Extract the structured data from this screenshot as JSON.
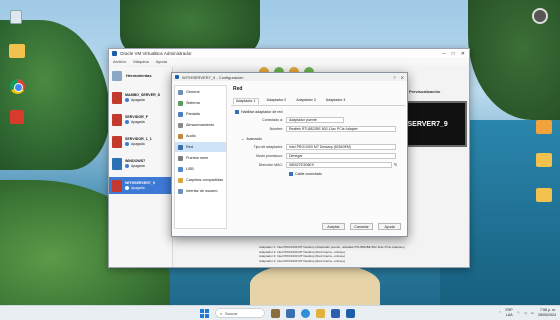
{
  "window": {
    "title": "Oracle VM VirtualBox Administrador",
    "menu": [
      "Archivo",
      "Máquina",
      "Ayuda"
    ]
  },
  "sidebar": {
    "tools_label": "Herramientas",
    "vms": [
      {
        "name": "MAMBO_SERVER_D",
        "state": "Apagada"
      },
      {
        "name": "SERVIDOR_F",
        "state": "Apagada"
      },
      {
        "name": "SERVIDOR_1_1",
        "state": "Apagada"
      },
      {
        "name": "WINDOWS7",
        "state": "Apagada"
      },
      {
        "name": "WITHSERVER7_9",
        "state": "Apagada",
        "selected": true
      }
    ]
  },
  "preview": {
    "header": "Previsualización",
    "screen_text": "THSERVER7_9"
  },
  "details_lines": [
    "Adaptador 1:  Intel PRO/1000 MT Desktop (Adaptador puente, «Realtek RTL8822BE 802.11ac PCIe Adapter»)",
    "Adaptador 2:  Intel PRO/1000 MT Desktop (Red interna, «intnet»)",
    "Adaptador 3:  Intel PRO/1000 MT Desktop (Red interna, «intnet»)",
    "Adaptador 4:  Intel PRO/1000 MT Desktop (Red interna, «intnet»)"
  ],
  "dialog": {
    "title": "WITHSERVER7_9 - Configuración",
    "nav": [
      "General",
      "Sistema",
      "Pantalla",
      "Almacenamiento",
      "Audio",
      "Red",
      "Puertos serie",
      "USB",
      "Carpetas compartidas",
      "Interfaz de usuario"
    ],
    "active_nav": 5,
    "section_title": "Red",
    "tabs": [
      "Adaptador 1",
      "Adaptador 2",
      "Adaptador 3",
      "Adaptador 4"
    ],
    "enable_label": "Habilitar adaptador de red",
    "attached_label": "Conectado a:",
    "attached_value": "Adaptador puente",
    "name_label": "Nombre:",
    "name_value": "Realtek RTL8822BE 802.11ac PCIe Adapter",
    "advanced_label": "Avanzado",
    "adapter_type_label": "Tipo de adaptador:",
    "adapter_type_value": "Intel PRO/1000 MT Desktop (82540EM)",
    "promisc_label": "Modo promiscuo:",
    "promisc_value": "Denegar",
    "mac_label": "Dirección MAC:",
    "mac_value": "080027E3D6E9",
    "cable_label": "Cable conectado",
    "buttons": {
      "ok": "Aceptar",
      "cancel": "Cancelar",
      "help": "Ayuda"
    }
  },
  "taskbar": {
    "search_placeholder": "Buscar",
    "lang_top": "ESP",
    "lang_bottom": "LAA",
    "time": "7:58 p. m.",
    "date": "28/05/2024"
  },
  "colors": {
    "accent": "#3d7ad6",
    "vm_thumb": "#c4392d"
  }
}
